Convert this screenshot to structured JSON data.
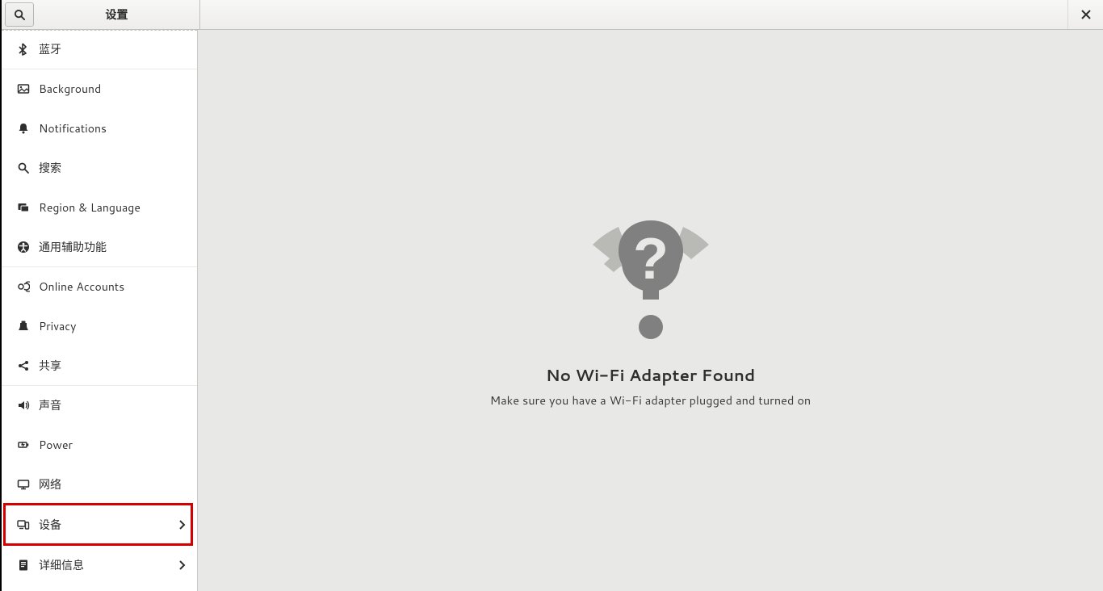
{
  "header": {
    "title": "设置"
  },
  "sidebar": {
    "items": [
      {
        "icon": "bluetooth-icon",
        "label": "蓝牙",
        "sep": true,
        "chevron": false
      },
      {
        "icon": "background-icon",
        "label": "Background",
        "sep": false,
        "chevron": false
      },
      {
        "icon": "notifications-icon",
        "label": "Notifications",
        "sep": false,
        "chevron": false
      },
      {
        "icon": "search-icon",
        "label": "搜索",
        "sep": false,
        "chevron": false
      },
      {
        "icon": "region-language-icon",
        "label": "Region & Language",
        "sep": false,
        "chevron": false
      },
      {
        "icon": "accessibility-icon",
        "label": "通用辅助功能",
        "sep": true,
        "chevron": false
      },
      {
        "icon": "online-accounts-icon",
        "label": "Online Accounts",
        "sep": false,
        "chevron": false
      },
      {
        "icon": "privacy-icon",
        "label": "Privacy",
        "sep": false,
        "chevron": false
      },
      {
        "icon": "sharing-icon",
        "label": "共享",
        "sep": true,
        "chevron": false
      },
      {
        "icon": "sound-icon",
        "label": "声音",
        "sep": false,
        "chevron": false
      },
      {
        "icon": "power-icon",
        "label": "Power",
        "sep": false,
        "chevron": false
      },
      {
        "icon": "network-icon",
        "label": "网络",
        "sep": false,
        "chevron": false
      },
      {
        "icon": "devices-icon",
        "label": "设备",
        "sep": false,
        "chevron": true
      },
      {
        "icon": "details-icon",
        "label": "详细信息",
        "sep": false,
        "chevron": true
      }
    ]
  },
  "content": {
    "heading": "No Wi-Fi Adapter Found",
    "subtext": "Make sure you have a Wi-Fi adapter plugged and turned on"
  },
  "highlight": {
    "target_index": 12
  }
}
